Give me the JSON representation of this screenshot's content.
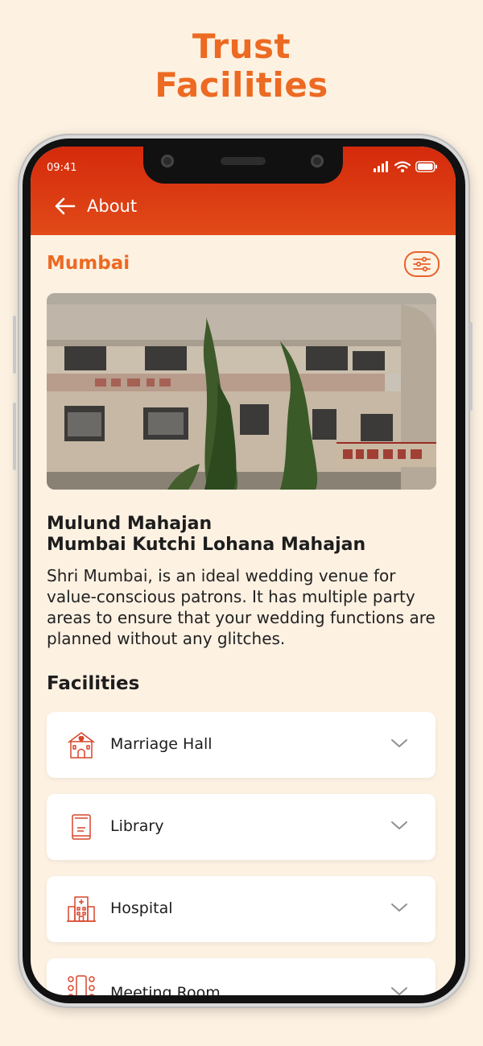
{
  "promo": {
    "title_line1": "Trust",
    "title_line2": "Facilities"
  },
  "status_bar": {
    "time": "09:41"
  },
  "appbar": {
    "title": "About"
  },
  "city": {
    "name": "Mumbai"
  },
  "venue": {
    "name_line1": "Mulund Mahajan",
    "name_line2": "Mumbai Kutchi Lohana Mahajan",
    "description": "Shri Mumbai, is an ideal wedding venue for value-conscious patrons. It has multiple party areas to ensure that your wedding functions are planned without any glitches."
  },
  "facilities": {
    "heading": "Facilities",
    "items": [
      {
        "label": "Marriage Hall",
        "icon": "wedding-hall-icon"
      },
      {
        "label": "Library",
        "icon": "book-icon"
      },
      {
        "label": "Hospital",
        "icon": "hospital-icon"
      },
      {
        "label": "Meeting Room",
        "icon": "meeting-room-icon"
      }
    ]
  },
  "colors": {
    "accent": "#ec6a22",
    "appbar_top": "#d42a0c",
    "appbar_bottom": "#e14a18",
    "background": "#fdf1e2",
    "icon_red": "#d9452b"
  }
}
